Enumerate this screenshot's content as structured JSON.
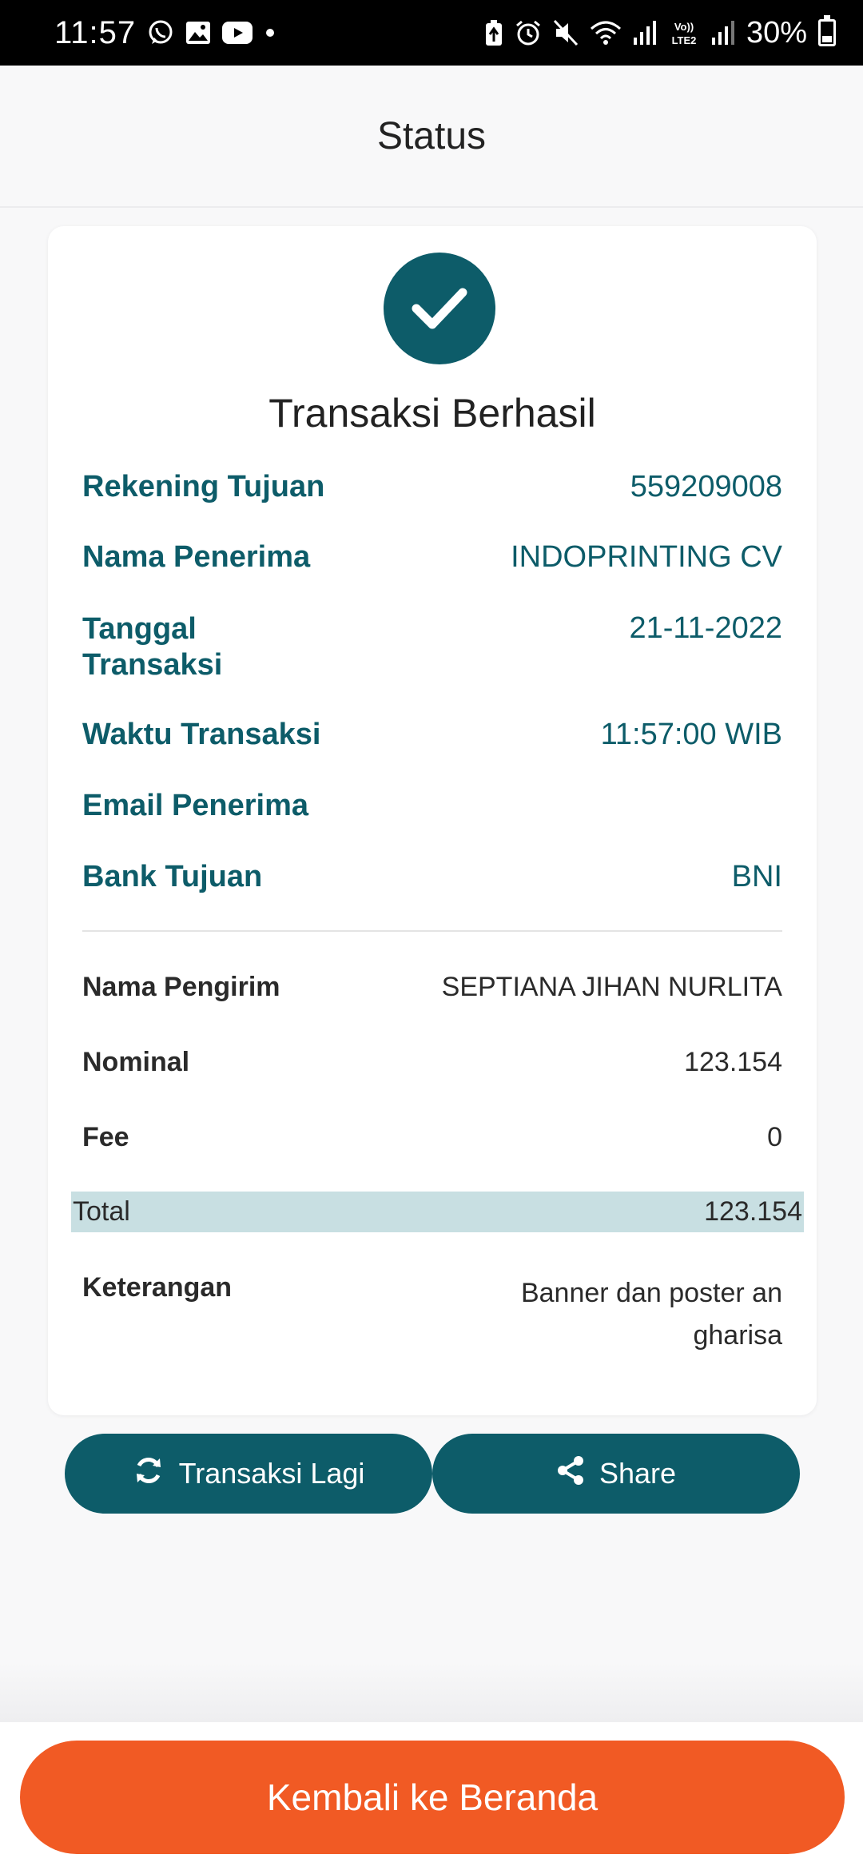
{
  "status_bar": {
    "time": "11:57",
    "battery_percent": "30%",
    "left_icons": [
      "whatsapp-icon",
      "gallery-icon",
      "youtube-icon",
      "dot-icon"
    ],
    "right_icons": [
      "battery-saver-icon",
      "alarm-icon",
      "mute-icon",
      "wifi-icon",
      "signal-icon",
      "volte-icon",
      "signal-icon",
      "battery-icon"
    ]
  },
  "header": {
    "title": "Status"
  },
  "card": {
    "title": "Transaksi Berhasil",
    "details": [
      {
        "label": "Rekening Tujuan",
        "value": "559209008"
      },
      {
        "label": "Nama Penerima",
        "value": "INDOPRINTING CV"
      },
      {
        "label": "Tanggal\nTransaksi",
        "value": "21-11-2022"
      },
      {
        "label": "Waktu Transaksi",
        "value": "11:57:00 WIB"
      },
      {
        "label": "Email Penerima",
        "value": ""
      },
      {
        "label": "Bank Tujuan",
        "value": "BNI"
      }
    ],
    "summary": [
      {
        "label": "Nama Pengirim",
        "value": "SEPTIANA JIHAN NURLITA"
      },
      {
        "label": "Nominal",
        "value": "123.154"
      },
      {
        "label": "Fee",
        "value": "0"
      }
    ],
    "total": {
      "label": "Total",
      "value": "123.154"
    },
    "note": {
      "label": "Keterangan",
      "value": "Banner dan poster an\ngharisa"
    }
  },
  "actions": {
    "again_label": "Transaksi Lagi",
    "share_label": "Share"
  },
  "footer": {
    "home_label": "Kembali ke Beranda"
  },
  "colors": {
    "teal": "#0d5c69",
    "orange": "#f15a24",
    "total_bg": "#c8dfe2"
  }
}
